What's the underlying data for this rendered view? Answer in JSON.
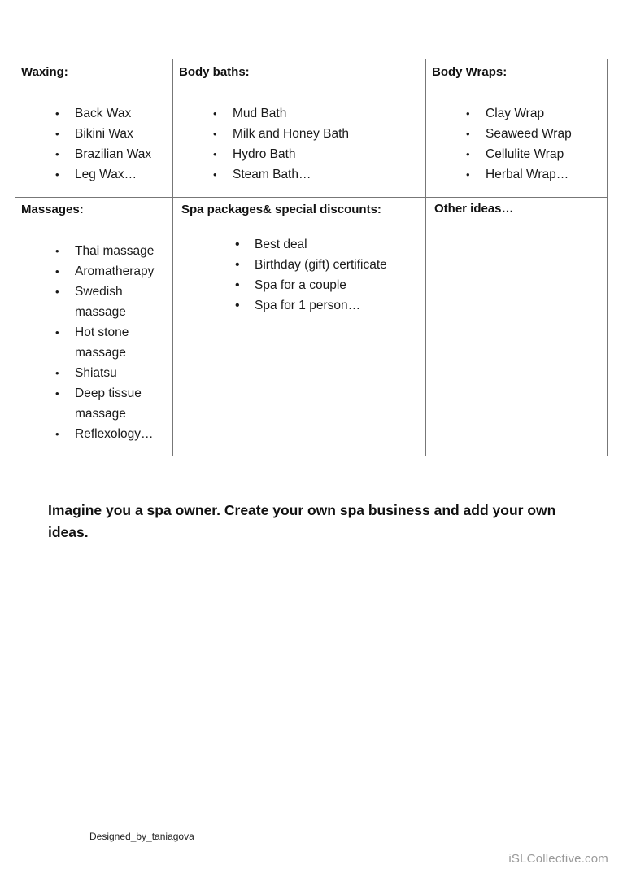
{
  "table": {
    "cells": [
      {
        "heading": "Waxing:",
        "items": [
          "Back Wax",
          "Bikini Wax",
          "Brazilian Wax",
          "Leg Wax…"
        ]
      },
      {
        "heading": "Body baths:",
        "items": [
          "Mud Bath",
          "Milk and Honey Bath",
          "Hydro Bath",
          "Steam Bath…"
        ]
      },
      {
        "heading": "Body Wraps:",
        "items": [
          "Clay Wrap",
          "Seaweed Wrap",
          "Cellulite Wrap",
          "Herbal Wrap…"
        ]
      },
      {
        "heading": "Massages:",
        "items": [
          "Thai massage",
          "Aromatherapy",
          "Swedish massage",
          "Hot stone massage",
          "Shiatsu",
          "Deep tissue massage",
          "Reflexology…"
        ]
      },
      {
        "heading": "Spa packages& special discounts:",
        "items": [
          "Best deal",
          "Birthday (gift) certificate",
          "Spa for a couple",
          "Spa for 1 person…"
        ]
      },
      {
        "heading": "Other ideas…",
        "items": []
      }
    ]
  },
  "task": "Imagine you a spa owner. Create your own spa business and add your own ideas.",
  "footer": {
    "credit": "Designed_by_taniagova",
    "brand": "iSLCollective.com"
  }
}
